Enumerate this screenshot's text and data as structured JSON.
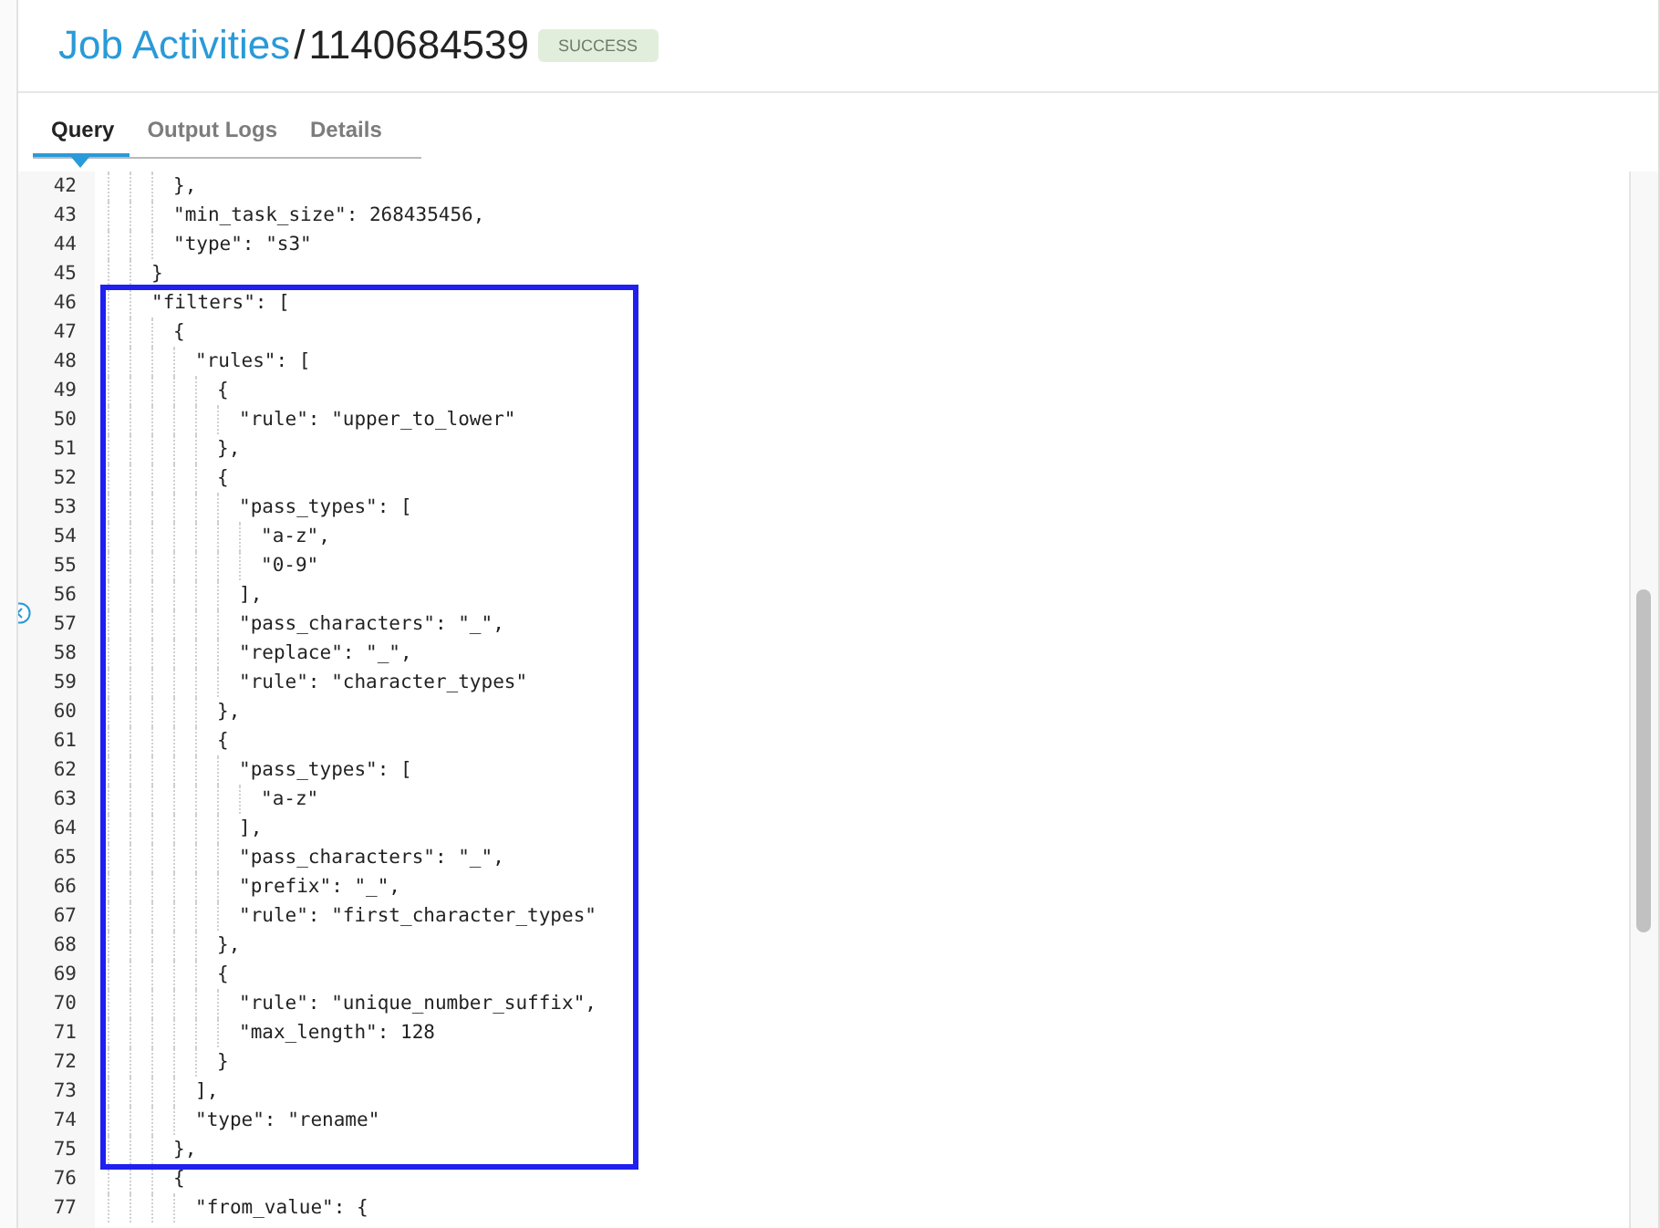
{
  "breadcrumb": {
    "parent": "Job Activities",
    "separator": "/",
    "current": "1140684539",
    "status": "SUCCESS"
  },
  "tabs": [
    {
      "label": "Query",
      "selected": true
    },
    {
      "label": "Output Logs",
      "selected": false
    },
    {
      "label": "Details",
      "selected": false
    }
  ],
  "code": {
    "lines": [
      {
        "number": "42",
        "text": "      },"
      },
      {
        "number": "43",
        "text": "      \"min_task_size\": 268435456,"
      },
      {
        "number": "44",
        "text": "      \"type\": \"s3\""
      },
      {
        "number": "45",
        "text": "    }"
      },
      {
        "number": "46",
        "text": "    \"filters\": ["
      },
      {
        "number": "47",
        "text": "      {"
      },
      {
        "number": "48",
        "text": "        \"rules\": ["
      },
      {
        "number": "49",
        "text": "          {"
      },
      {
        "number": "50",
        "text": "            \"rule\": \"upper_to_lower\""
      },
      {
        "number": "51",
        "text": "          },"
      },
      {
        "number": "52",
        "text": "          {"
      },
      {
        "number": "53",
        "text": "            \"pass_types\": ["
      },
      {
        "number": "54",
        "text": "              \"a-z\","
      },
      {
        "number": "55",
        "text": "              \"0-9\""
      },
      {
        "number": "56",
        "text": "            ],"
      },
      {
        "number": "57",
        "text": "            \"pass_characters\": \"_\","
      },
      {
        "number": "58",
        "text": "            \"replace\": \"_\","
      },
      {
        "number": "59",
        "text": "            \"rule\": \"character_types\""
      },
      {
        "number": "60",
        "text": "          },"
      },
      {
        "number": "61",
        "text": "          {"
      },
      {
        "number": "62",
        "text": "            \"pass_types\": ["
      },
      {
        "number": "63",
        "text": "              \"a-z\""
      },
      {
        "number": "64",
        "text": "            ],"
      },
      {
        "number": "65",
        "text": "            \"pass_characters\": \"_\","
      },
      {
        "number": "66",
        "text": "            \"prefix\": \"_\","
      },
      {
        "number": "67",
        "text": "            \"rule\": \"first_character_types\""
      },
      {
        "number": "68",
        "text": "          },"
      },
      {
        "number": "69",
        "text": "          {"
      },
      {
        "number": "70",
        "text": "            \"rule\": \"unique_number_suffix\","
      },
      {
        "number": "71",
        "text": "            \"max_length\": 128"
      },
      {
        "number": "72",
        "text": "          }"
      },
      {
        "number": "73",
        "text": "        ],"
      },
      {
        "number": "74",
        "text": "        \"type\": \"rename\""
      },
      {
        "number": "75",
        "text": "      },"
      },
      {
        "number": "76",
        "text": "      {"
      },
      {
        "number": "77",
        "text": "        \"from_value\": {"
      }
    ]
  }
}
